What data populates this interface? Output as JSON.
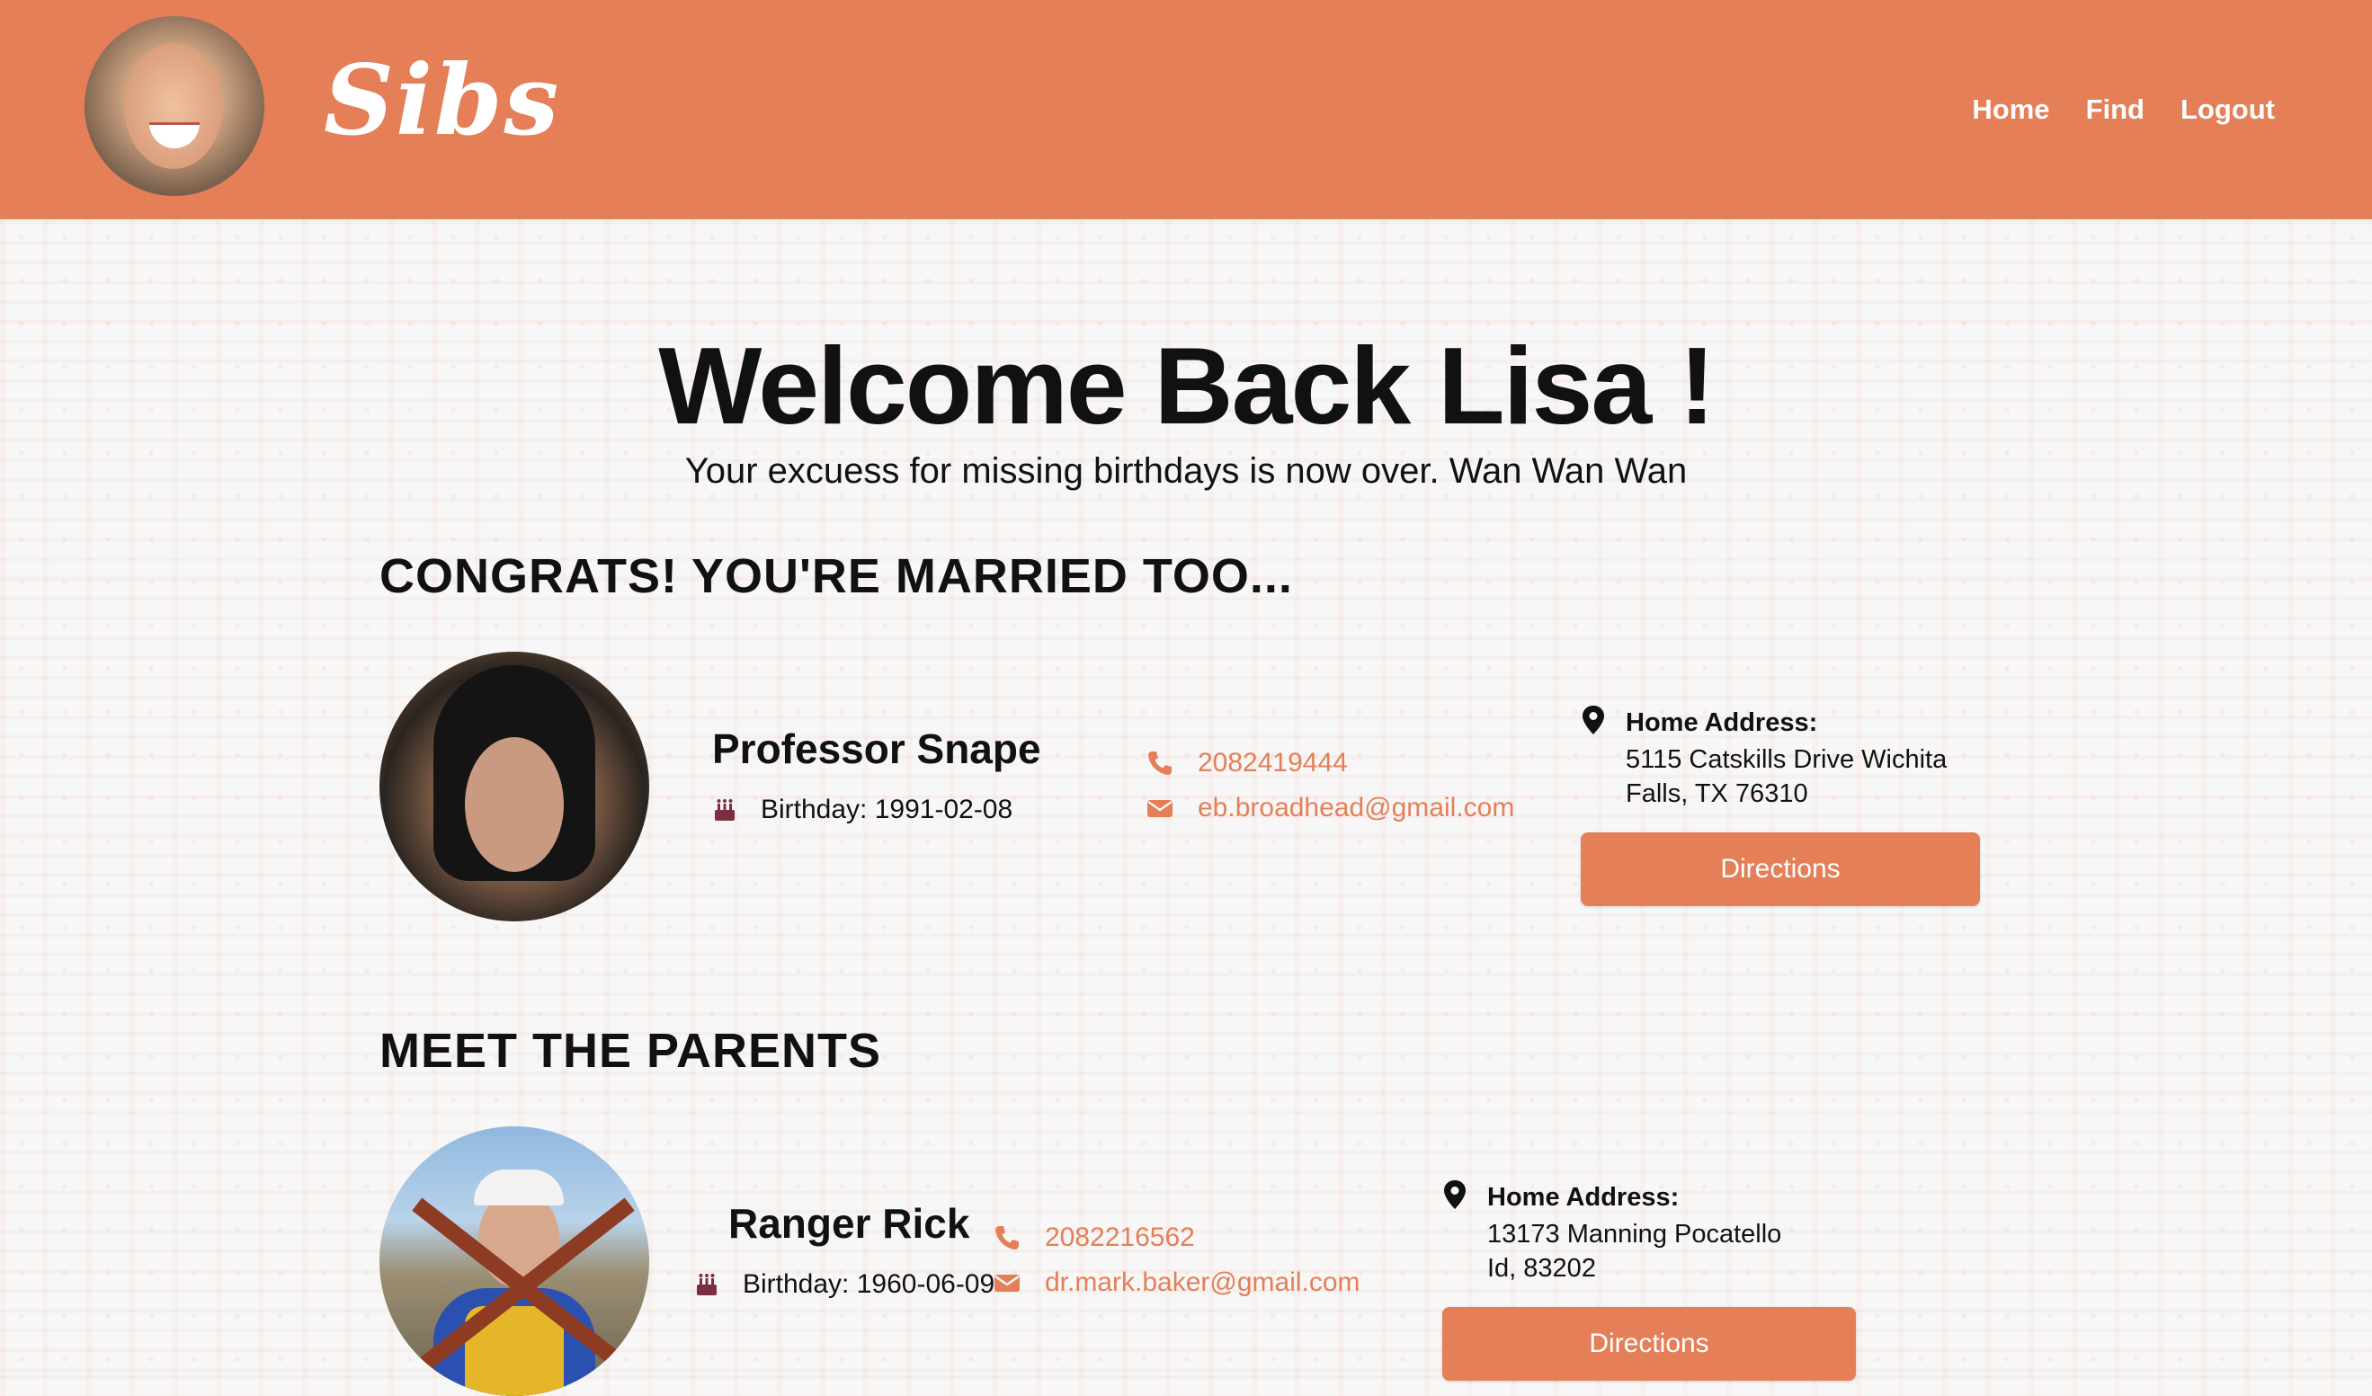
{
  "header": {
    "logo": "Sibs",
    "nav": {
      "home": "Home",
      "find": "Find",
      "logout": "Logout"
    }
  },
  "welcome": {
    "title": "Welcome Back Lisa !",
    "subtitle": "Your excuess for missing birthdays is now over. Wan Wan Wan"
  },
  "sections": {
    "spouse_title": "CONGRATS! YOU'RE MARRIED TOO...",
    "parents_title": "MEET THE PARENTS"
  },
  "spouse": {
    "name": "Professor Snape",
    "birthday": "Birthday: 1991-02-08",
    "phone": "2082419444",
    "email": "eb.broadhead@gmail.com",
    "address_label": "Home Address:",
    "address": "5115 Catskills Drive Wichita Falls, TX 76310",
    "directions": "Directions"
  },
  "parent": {
    "name": "Ranger Rick",
    "birthday": "Birthday: 1960-06-09",
    "phone": "2082216562",
    "email": "dr.mark.baker@gmail.com",
    "address_label": "Home Address:",
    "address": "13173 Manning Pocatello Id, 83202",
    "directions": "Directions"
  },
  "colors": {
    "accent": "#e47f58",
    "text": "#111111",
    "background": "#f7f7f7",
    "icon_dark": "#7a2e3e"
  },
  "icons": [
    "cake-icon",
    "phone-icon",
    "envelope-icon",
    "map-pin-icon"
  ]
}
